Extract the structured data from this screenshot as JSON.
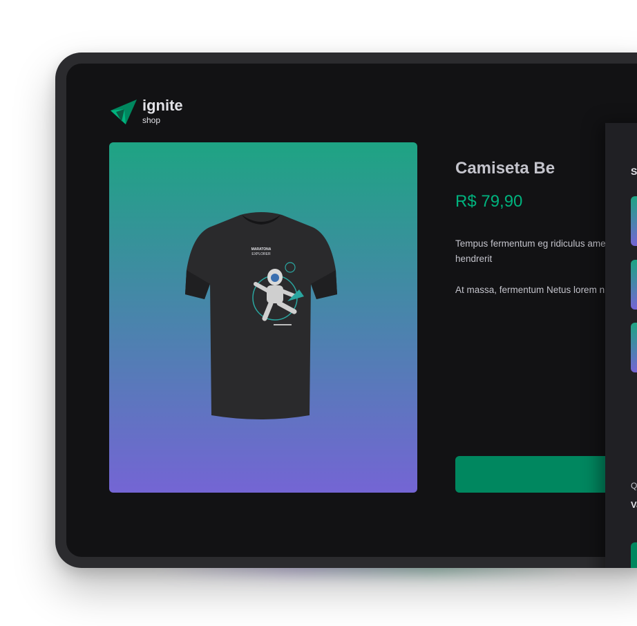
{
  "brand": {
    "name": "ignite",
    "subtitle": "shop"
  },
  "product": {
    "title": "Camiseta Be",
    "price": "R$ 79,90",
    "description": [
      "Tempus fermentum eg ridiculus amet. Bibend metus donec hendrerit",
      "At massa, fermentum Netus lorem nulla nulla"
    ],
    "shirt_print": [
      "MARATONA",
      "EXPLORER"
    ]
  },
  "cart": {
    "title": "Sacola de co",
    "items_count_visible": 3,
    "quantity_label": "Quantidade",
    "total_label": "Valor total"
  },
  "colors": {
    "background": "#121214",
    "accent": "#00875f",
    "price": "#00b37e",
    "gradient_top": "#1ea483",
    "gradient_bottom": "#7465d4"
  }
}
